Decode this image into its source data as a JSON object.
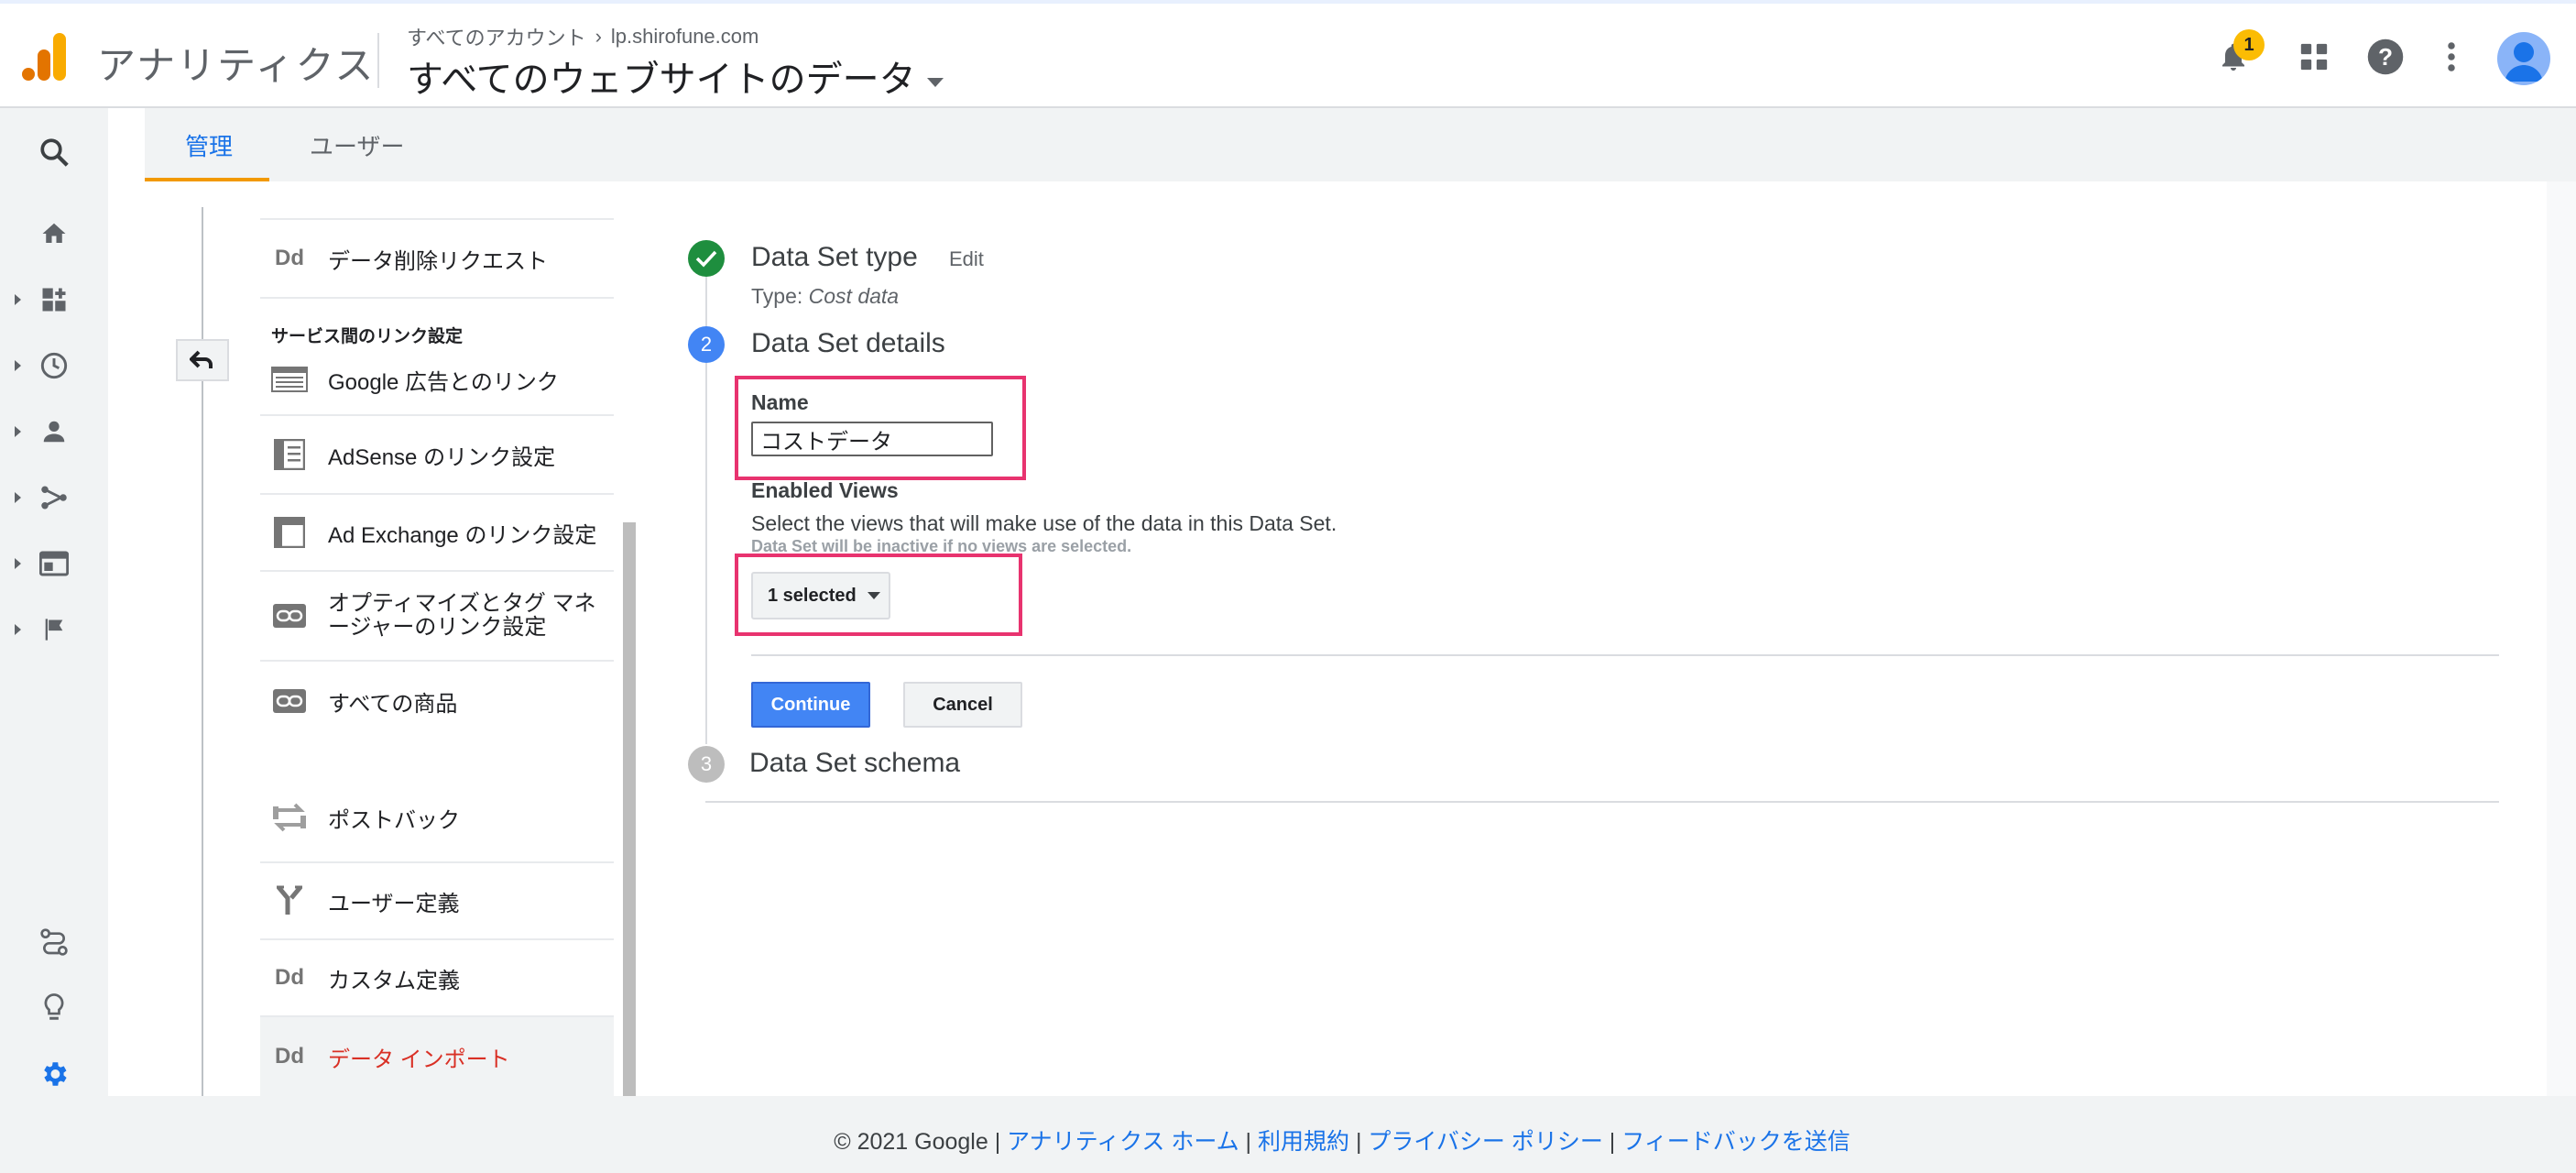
{
  "header": {
    "app_title": "アナリティクス",
    "breadcrumb_account": "すべてのアカウント",
    "breadcrumb_property": "lp.shirofune.com",
    "view_name": "すべてのウェブサイトのデータ",
    "notification_count": "1"
  },
  "tabs": [
    {
      "label": "管理"
    },
    {
      "label": "ユーザー"
    }
  ],
  "nav": {
    "items_top": [
      {
        "label": "データ削除リクエスト",
        "icon": "dd-icon"
      }
    ],
    "section_title": "サービス間のリンク設定",
    "items_links": [
      {
        "label": "Google 広告とのリンク",
        "icon": "google-ads-icon"
      },
      {
        "label": "AdSense のリンク設定",
        "icon": "adsense-icon"
      },
      {
        "label": "Ad Exchange のリンク設定",
        "icon": "ad-exchange-icon"
      },
      {
        "label": "オプティマイズとタグ マネージャーのリンク設定",
        "label_line1": "オプティマイズとタグ マネ",
        "label_line2": "ージャーのリンク設定",
        "icon": "link-icon"
      },
      {
        "label": "すべての商品",
        "icon": "link-icon"
      }
    ],
    "items_bottom": [
      {
        "label": "ポストバック",
        "icon": "postback-icon"
      },
      {
        "label": "ユーザー定義",
        "icon": "fork-icon"
      },
      {
        "label": "カスタム定義",
        "icon": "dd-icon"
      },
      {
        "label": "データ インポート",
        "icon": "dd-icon",
        "active": true
      }
    ],
    "dd_glyph": "Dd"
  },
  "form": {
    "step1": {
      "number": "1",
      "title": "Data Set type",
      "edit": "Edit",
      "type_prefix": "Type:",
      "type_value": "Cost data"
    },
    "step2": {
      "number": "2",
      "title": "Data Set details"
    },
    "name_label": "Name",
    "name_value": "コストデータ",
    "views_label": "Enabled Views",
    "views_help": "Select the views that will make use of the data in this Data Set.",
    "views_subhelp": "Data Set will be inactive if no views are selected.",
    "views_selected": "1 selected",
    "continue_label": "Continue",
    "cancel_label": "Cancel",
    "step3": {
      "number": "3",
      "title": "Data Set schema"
    }
  },
  "footer": {
    "copyright": "© 2021 Google",
    "sep": " | ",
    "links": [
      "アナリティクス ホーム",
      "利用規約",
      "プライバシー ポリシー",
      "フィードバックを送信"
    ]
  },
  "colors": {
    "accent": "#1a73e8",
    "tab_underline": "#f29900",
    "highlight": "#e8336f",
    "step_done": "#1e8e3e",
    "step_active": "#4285f4",
    "step_pending": "#bdbdbd",
    "active_nav": "#d93025"
  }
}
